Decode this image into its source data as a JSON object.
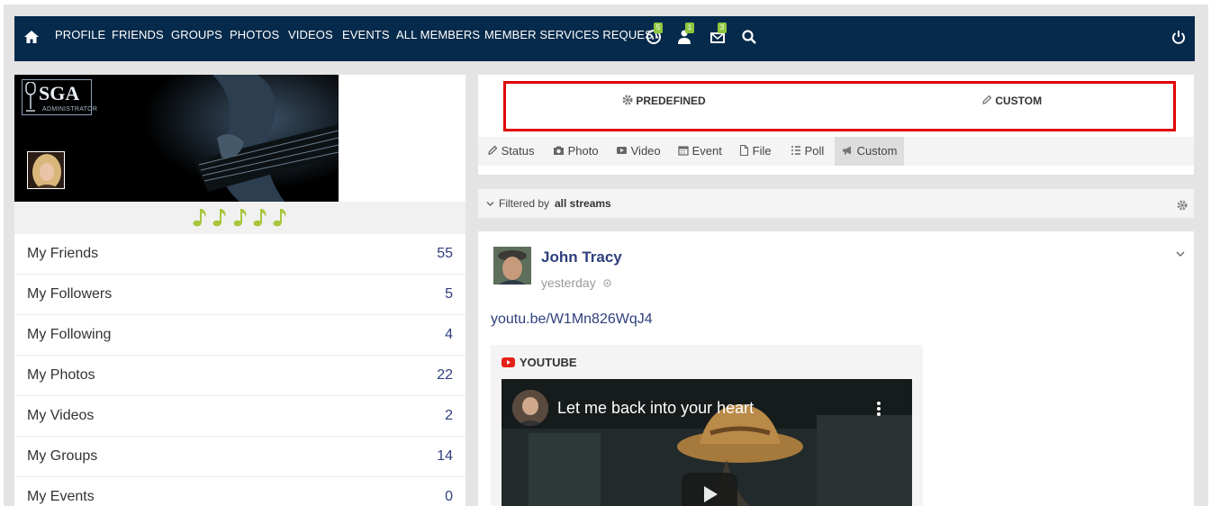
{
  "nav": {
    "items": [
      "PROFILE",
      "FRIENDS",
      "GROUPS",
      "PHOTOS",
      "VIDEOS",
      "EVENTS",
      "ALL MEMBERS",
      "MEMBER SERVICES REQUEST"
    ],
    "badges": {
      "globe": "5",
      "friends": "1",
      "messages": "3"
    }
  },
  "cover": {
    "logo_text": "SGA",
    "logo_subtitle": "ADMINISTRATOR"
  },
  "sidebar": {
    "items": [
      {
        "label": "My Friends",
        "count": "55"
      },
      {
        "label": "My Followers",
        "count": "5"
      },
      {
        "label": "My Following",
        "count": "4"
      },
      {
        "label": "My Photos",
        "count": "22"
      },
      {
        "label": "My Videos",
        "count": "2"
      },
      {
        "label": "My Groups",
        "count": "14"
      },
      {
        "label": "My Events",
        "count": "0"
      }
    ]
  },
  "composer": {
    "modes": {
      "predefined": "PREDEFINED",
      "custom": "CUSTOM"
    },
    "tabs": [
      "Status",
      "Photo",
      "Video",
      "Event",
      "File",
      "Poll",
      "Custom"
    ]
  },
  "filter": {
    "prefix": "Filtered by",
    "value": "all streams"
  },
  "post": {
    "author": "John Tracy",
    "time": "yesterday",
    "link": "youtu.be/W1Mn826WqJ4",
    "embed_source": "YOUTUBE",
    "video_title": "Let me back into your heart"
  },
  "colors": {
    "nav_bg": "#062a4b",
    "badge": "#8dc63f",
    "link": "#2e3f7c",
    "highlight_border": "#e00000"
  }
}
